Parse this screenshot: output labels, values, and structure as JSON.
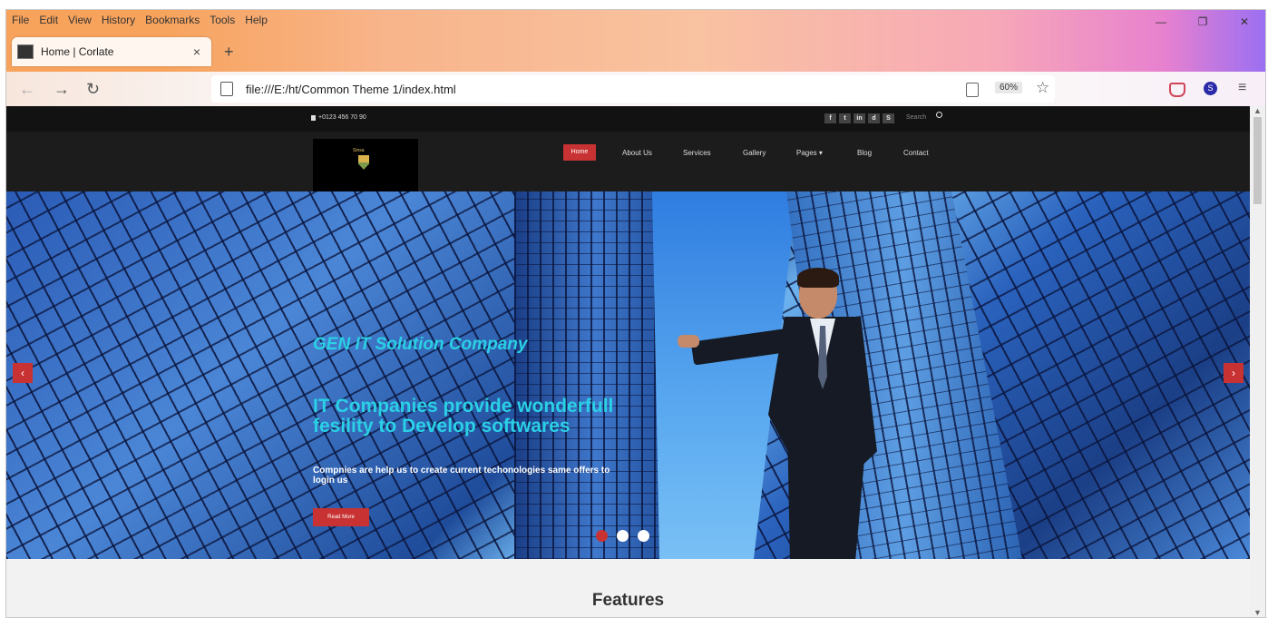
{
  "menubar": [
    "File",
    "Edit",
    "View",
    "History",
    "Bookmarks",
    "Tools",
    "Help"
  ],
  "tab": {
    "title": "Home | Corlate",
    "close": "×"
  },
  "newtab": "+",
  "nav": {
    "back": "←",
    "forward": "→",
    "reload": "↻"
  },
  "url": "file:///E:/ht/Common Theme 1/index.html",
  "zoom": "60%",
  "account_initial": "S",
  "site": {
    "phone": "+0123 456 70 90",
    "socials": [
      "f",
      "t",
      "in",
      "d",
      "S"
    ],
    "search_placeholder": "Search",
    "logo_text": "Sinsa",
    "menu": [
      "Home",
      "About Us",
      "Services",
      "Gallery",
      "Pages ▾",
      "Blog",
      "Contact"
    ],
    "hero": {
      "subtitle": "GEN IT Solution Company",
      "title": "IT Companies provide wonderfull fesility to Develop softwares",
      "description": "Compnies are help us to create current techonologies same offers to login us",
      "button": "Read More"
    },
    "slider_arrows": {
      "prev": "‹",
      "next": "›"
    },
    "section_title": "Features"
  },
  "colors": {
    "accent_red": "#c83232",
    "hero_text": "#2ad0e6"
  }
}
